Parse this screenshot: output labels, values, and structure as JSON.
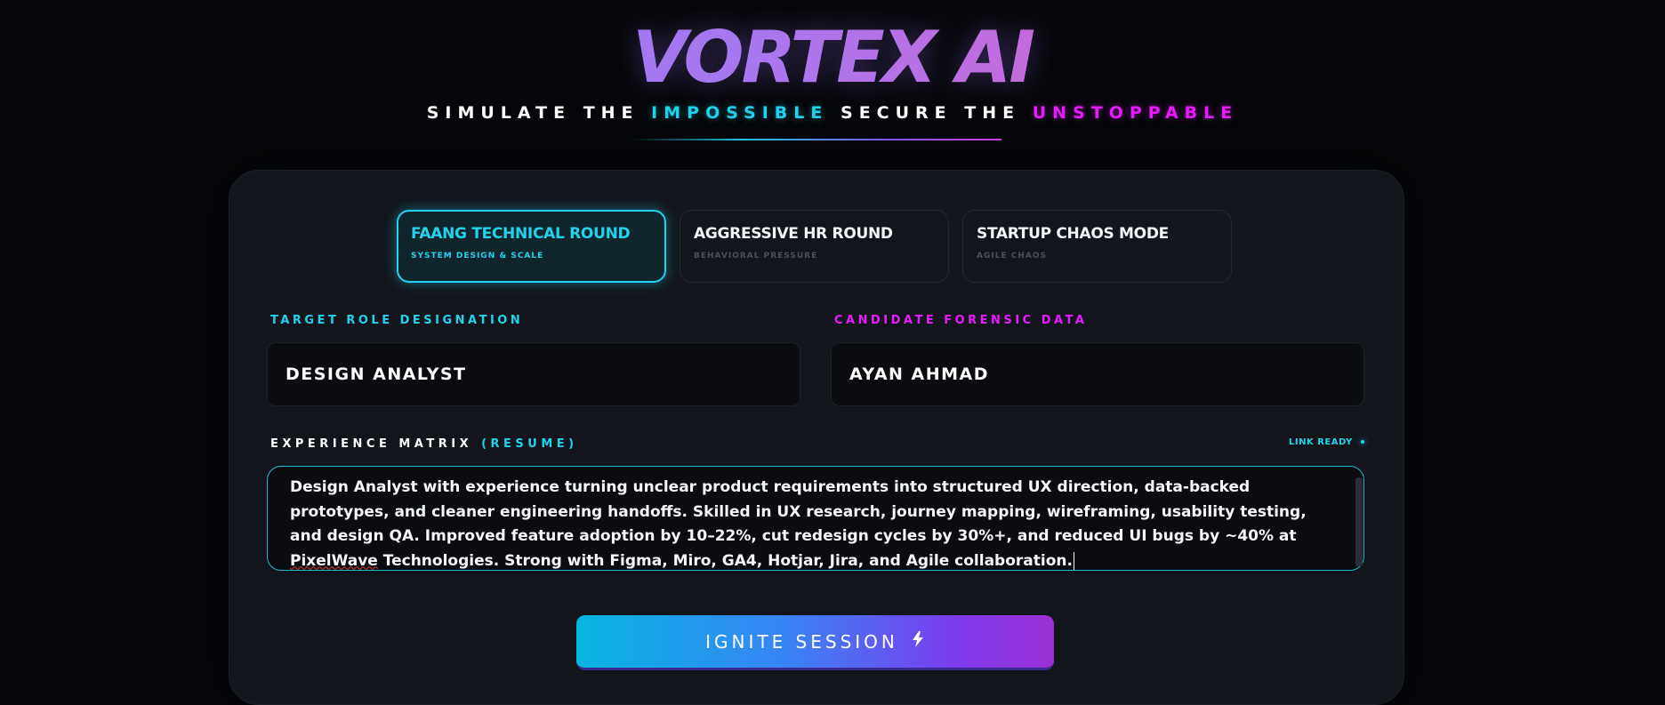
{
  "brand": {
    "title": "VORTEX AI"
  },
  "tagline": {
    "part1": "SIMULATE THE",
    "highlight1": "IMPOSSIBLE",
    "part2": "SECURE THE",
    "highlight2": "UNSTOPPABLE"
  },
  "modes": [
    {
      "title": "FAANG TECHNICAL ROUND",
      "subtitle": "SYSTEM DESIGN & SCALE",
      "active": true
    },
    {
      "title": "AGGRESSIVE HR ROUND",
      "subtitle": "BEHAVIORAL PRESSURE",
      "active": false
    },
    {
      "title": "STARTUP CHAOS MODE",
      "subtitle": "AGILE CHAOS",
      "active": false
    }
  ],
  "role": {
    "label": "TARGET ROLE DESIGNATION",
    "value": "DESIGN ANALYST"
  },
  "candidate": {
    "label": "CANDIDATE FORENSIC DATA",
    "value": "AYAN AHMAD"
  },
  "experience": {
    "label": "EXPERIENCE MATRIX",
    "label_accent": "(RESUME)",
    "status": "LINK READY",
    "text_before": "Design Analyst with experience turning unclear product requirements into structured UX direction, data-backed prototypes, and cleaner engineering handoffs. Skilled in UX research, journey mapping, wireframing, usability testing, and design QA. Improved feature adoption by 10–22%, cut redesign cycles by 30%+, and reduced UI bugs by ~40% at ",
    "text_flagged": "PixelWave",
    "text_after": " Technologies. Strong with Figma, Miro, GA4, Hotjar, Jira, and Agile collaboration."
  },
  "ignite": {
    "label": "IGNITE SESSION",
    "icon": "bolt-icon"
  },
  "colors": {
    "accent_cyan": "#22d3ee",
    "accent_magenta": "#e81cff",
    "background": "#06070a",
    "card": "#12151b"
  }
}
